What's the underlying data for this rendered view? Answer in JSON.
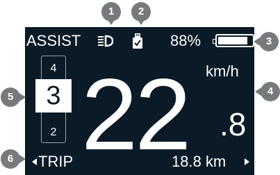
{
  "header": {
    "assist_label": "ASSIST",
    "battery_percent": "88%",
    "battery_level": 0.88
  },
  "assist_levels": {
    "up": "4",
    "current": "3",
    "down": "2"
  },
  "speed": {
    "integer": "22",
    "decimal": ".8",
    "unit": "km/h"
  },
  "footer": {
    "mode_label": "TRIP",
    "distance": "18.8 km"
  },
  "icons": {
    "headlight": "headlight-icon",
    "usb": "usb-charging-icon"
  },
  "callouts": [
    "1",
    "2",
    "3",
    "4",
    "5",
    "6"
  ],
  "colors": {
    "screen_bg": "#0a1a26",
    "text": "#ffffff",
    "callout_bg": "#777a7c"
  }
}
